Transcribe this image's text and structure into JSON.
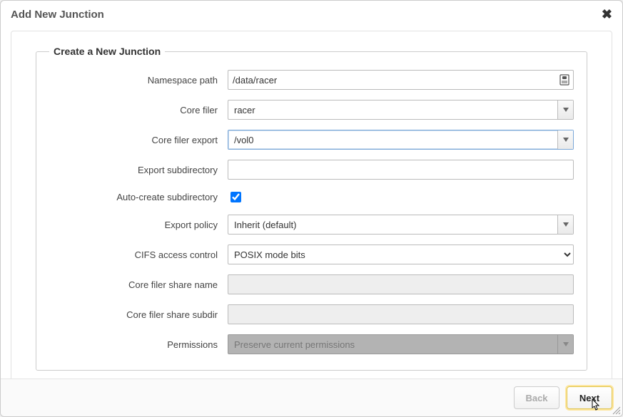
{
  "dialog": {
    "title": "Add New Junction"
  },
  "fieldset": {
    "legend": "Create a New Junction"
  },
  "labels": {
    "namespace_path": "Namespace path",
    "core_filer": "Core filer",
    "core_filer_export": "Core filer export",
    "export_subdir": "Export subdirectory",
    "auto_create": "Auto-create subdirectory",
    "export_policy": "Export policy",
    "cifs_access": "CIFS access control",
    "share_name": "Core filer share name",
    "share_subdir": "Core filer share subdir",
    "permissions": "Permissions"
  },
  "values": {
    "namespace_path": "/data/racer",
    "core_filer": "racer",
    "core_filer_export": "/vol0",
    "export_subdir": "",
    "auto_create": true,
    "export_policy": "Inherit (default)",
    "cifs_access": "POSIX mode bits",
    "share_name": "",
    "share_subdir": "",
    "permissions": "Preserve current permissions"
  },
  "buttons": {
    "back": "Back",
    "next": "Next"
  }
}
